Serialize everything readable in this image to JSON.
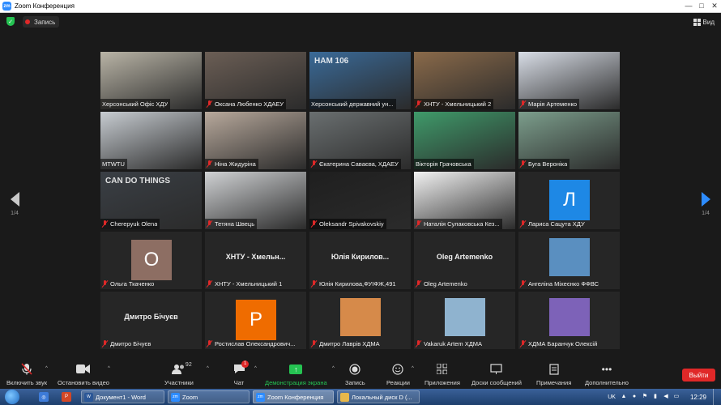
{
  "window": {
    "title": "Zoom Конференция",
    "controls": [
      "—",
      "□",
      "✕"
    ]
  },
  "topbar": {
    "recording_label": "Запись",
    "view_label": "Вид"
  },
  "pagination": {
    "left": "1/4",
    "right": "1/4"
  },
  "participants": [
    {
      "name": "Херсонський Офіс ХДУ",
      "muted": false,
      "type": "video",
      "bg": "#b9b4a6"
    },
    {
      "name": "Оксана Любенко ХДАЕУ",
      "muted": true,
      "type": "video",
      "bg": "#6b5e55"
    },
    {
      "name": "Херсонський державний ун...",
      "muted": false,
      "type": "video",
      "bg": "#3a6a98",
      "sign": "HAM 106"
    },
    {
      "name": "ХНТУ - Хмельницький 2",
      "muted": true,
      "type": "video",
      "bg": "#8a6a4a"
    },
    {
      "name": "Марія Артеменко",
      "muted": true,
      "type": "video",
      "bg": "#d8dde6"
    },
    {
      "name": "MTWTU",
      "muted": false,
      "type": "video",
      "bg": "#c7ccd1"
    },
    {
      "name": "Ніна Жидуріна",
      "muted": true,
      "type": "video",
      "bg": "#b8a99c"
    },
    {
      "name": "Єкатерина Саваєва, ХДАЕУ",
      "muted": true,
      "type": "video",
      "bg": "#6a6f70"
    },
    {
      "name": "Вікторія Грачовська",
      "muted": false,
      "type": "video",
      "bg": "#3f9a6a",
      "active": true
    },
    {
      "name": "Буга Вероніка",
      "muted": true,
      "type": "video",
      "bg": "#7c9e8c"
    },
    {
      "name": "Cherepyuk Olena",
      "muted": true,
      "type": "video",
      "bg": "#3a3f45",
      "sign": "CAN DO THINGS"
    },
    {
      "name": "Тетяна Швець",
      "muted": true,
      "type": "video",
      "bg": "#d0d2d4"
    },
    {
      "name": "Oleksandr Spivakovskiy",
      "muted": true,
      "type": "video",
      "bg": "#1f1f1f"
    },
    {
      "name": "Наталія Сулаковська Кез...",
      "muted": true,
      "type": "video",
      "bg": "#f2f2f2"
    },
    {
      "name": "Лариса Сацута ХДУ",
      "muted": true,
      "type": "avatar",
      "letter": "Л",
      "avatar_color": "#1e88e5"
    },
    {
      "name": "Ольга Ткаченко",
      "muted": true,
      "type": "avatar",
      "letter": "О",
      "avatar_color": "#8d6e63"
    },
    {
      "name": "ХНТУ - Хмельницький 1",
      "muted": true,
      "type": "text",
      "display": "ХНТУ - Хмельн..."
    },
    {
      "name": "Юлія Кирилова,ФУІФЖ,491",
      "muted": true,
      "type": "text",
      "display": "Юлія Кирилов..."
    },
    {
      "name": "Oleg Artemenko",
      "muted": true,
      "type": "text",
      "display": "Oleg Artemenko"
    },
    {
      "name": "Ангеліна Міхеєнко ФФВС",
      "muted": true,
      "type": "photo",
      "bg": "#5a8fc0"
    },
    {
      "name": "Дмитро Бічуєв",
      "muted": true,
      "type": "text",
      "display": "Дмитро Бічуєв"
    },
    {
      "name": "Ростислав Олександрович...",
      "muted": true,
      "type": "avatar",
      "letter": "Р",
      "avatar_color": "#ef6c00"
    },
    {
      "name": "Дмитро Лаврів ХДМА",
      "muted": true,
      "type": "photo",
      "bg": "#d68a4a"
    },
    {
      "name": "Vakaruk Artem ХДМА",
      "muted": true,
      "type": "photo",
      "bg": "#8fb3cf"
    },
    {
      "name": "ХДМА Баранчук Олексій",
      "muted": true,
      "type": "photo",
      "bg": "#7d62b8"
    }
  ],
  "toolbar": {
    "mute_label": "Включить звук",
    "video_label": "Остановить видео",
    "participants_label": "Участники",
    "participants_count": "92",
    "chat_label": "Чат",
    "chat_badge": "1",
    "share_label": "Демонстрация экрана",
    "record_label": "Запись",
    "reactions_label": "Реакции",
    "apps_label": "Приложения",
    "whiteboards_label": "Доски сообщений",
    "notes_label": "Примечания",
    "more_label": "Дополнительно",
    "leave_label": "Выйти"
  },
  "taskbar": {
    "tasks": [
      "Документ1 - Word",
      "Zoom",
      "Zoom Конференция",
      "Локальный диск D (..."
    ],
    "language": "UK",
    "clock": "12:29"
  }
}
